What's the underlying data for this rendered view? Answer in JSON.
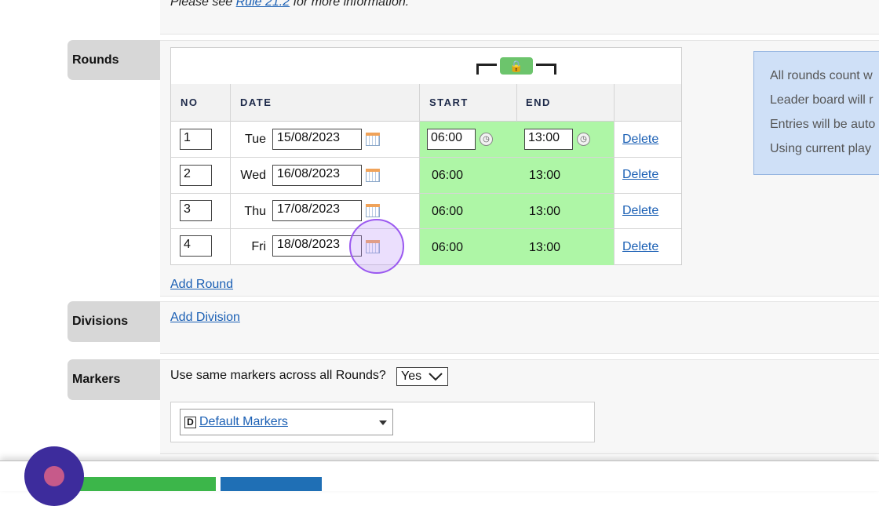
{
  "notice": {
    "prefix": "Please see",
    "rule_link": "Rule 21.2",
    "suffix": "for more information."
  },
  "sections": {
    "rounds": "Rounds",
    "divisions": "Divisions",
    "markers": "Markers"
  },
  "rounds_table": {
    "lock_icon": "lock-icon",
    "headers": {
      "no": "NO",
      "date": "DATE",
      "start": "START",
      "end": "END"
    },
    "rows": [
      {
        "no": "1",
        "day": "Tue",
        "date": "15/08/2023",
        "start": "06:00",
        "end": "13:00",
        "delete": "Delete",
        "editable_times": true
      },
      {
        "no": "2",
        "day": "Wed",
        "date": "16/08/2023",
        "start": "06:00",
        "end": "13:00",
        "delete": "Delete"
      },
      {
        "no": "3",
        "day": "Thu",
        "date": "17/08/2023",
        "start": "06:00",
        "end": "13:00",
        "delete": "Delete"
      },
      {
        "no": "4",
        "day": "Fri",
        "date": "18/08/2023",
        "start": "06:00",
        "end": "13:00",
        "delete": "Delete"
      }
    ],
    "add_round": "Add Round"
  },
  "info_box": {
    "lines": [
      "All rounds count w",
      "Leader board will r",
      "Entries will be auto",
      "Using current play"
    ]
  },
  "divisions": {
    "add_division": "Add Division"
  },
  "markers": {
    "question": "Use same markers across all Rounds?",
    "same_markers_value": "Yes",
    "marker_icon_letter": "D",
    "selected_markers": "Default Markers"
  },
  "colors": {
    "time_cells": "#aef6a6",
    "lock_button": "#6cc46c",
    "info_box": "#cfe0f7",
    "link": "#1a5fb4",
    "primary_button": "#3cb64a",
    "secondary_button": "#1f6fb5",
    "assistant_button": "#3d2c9c"
  }
}
